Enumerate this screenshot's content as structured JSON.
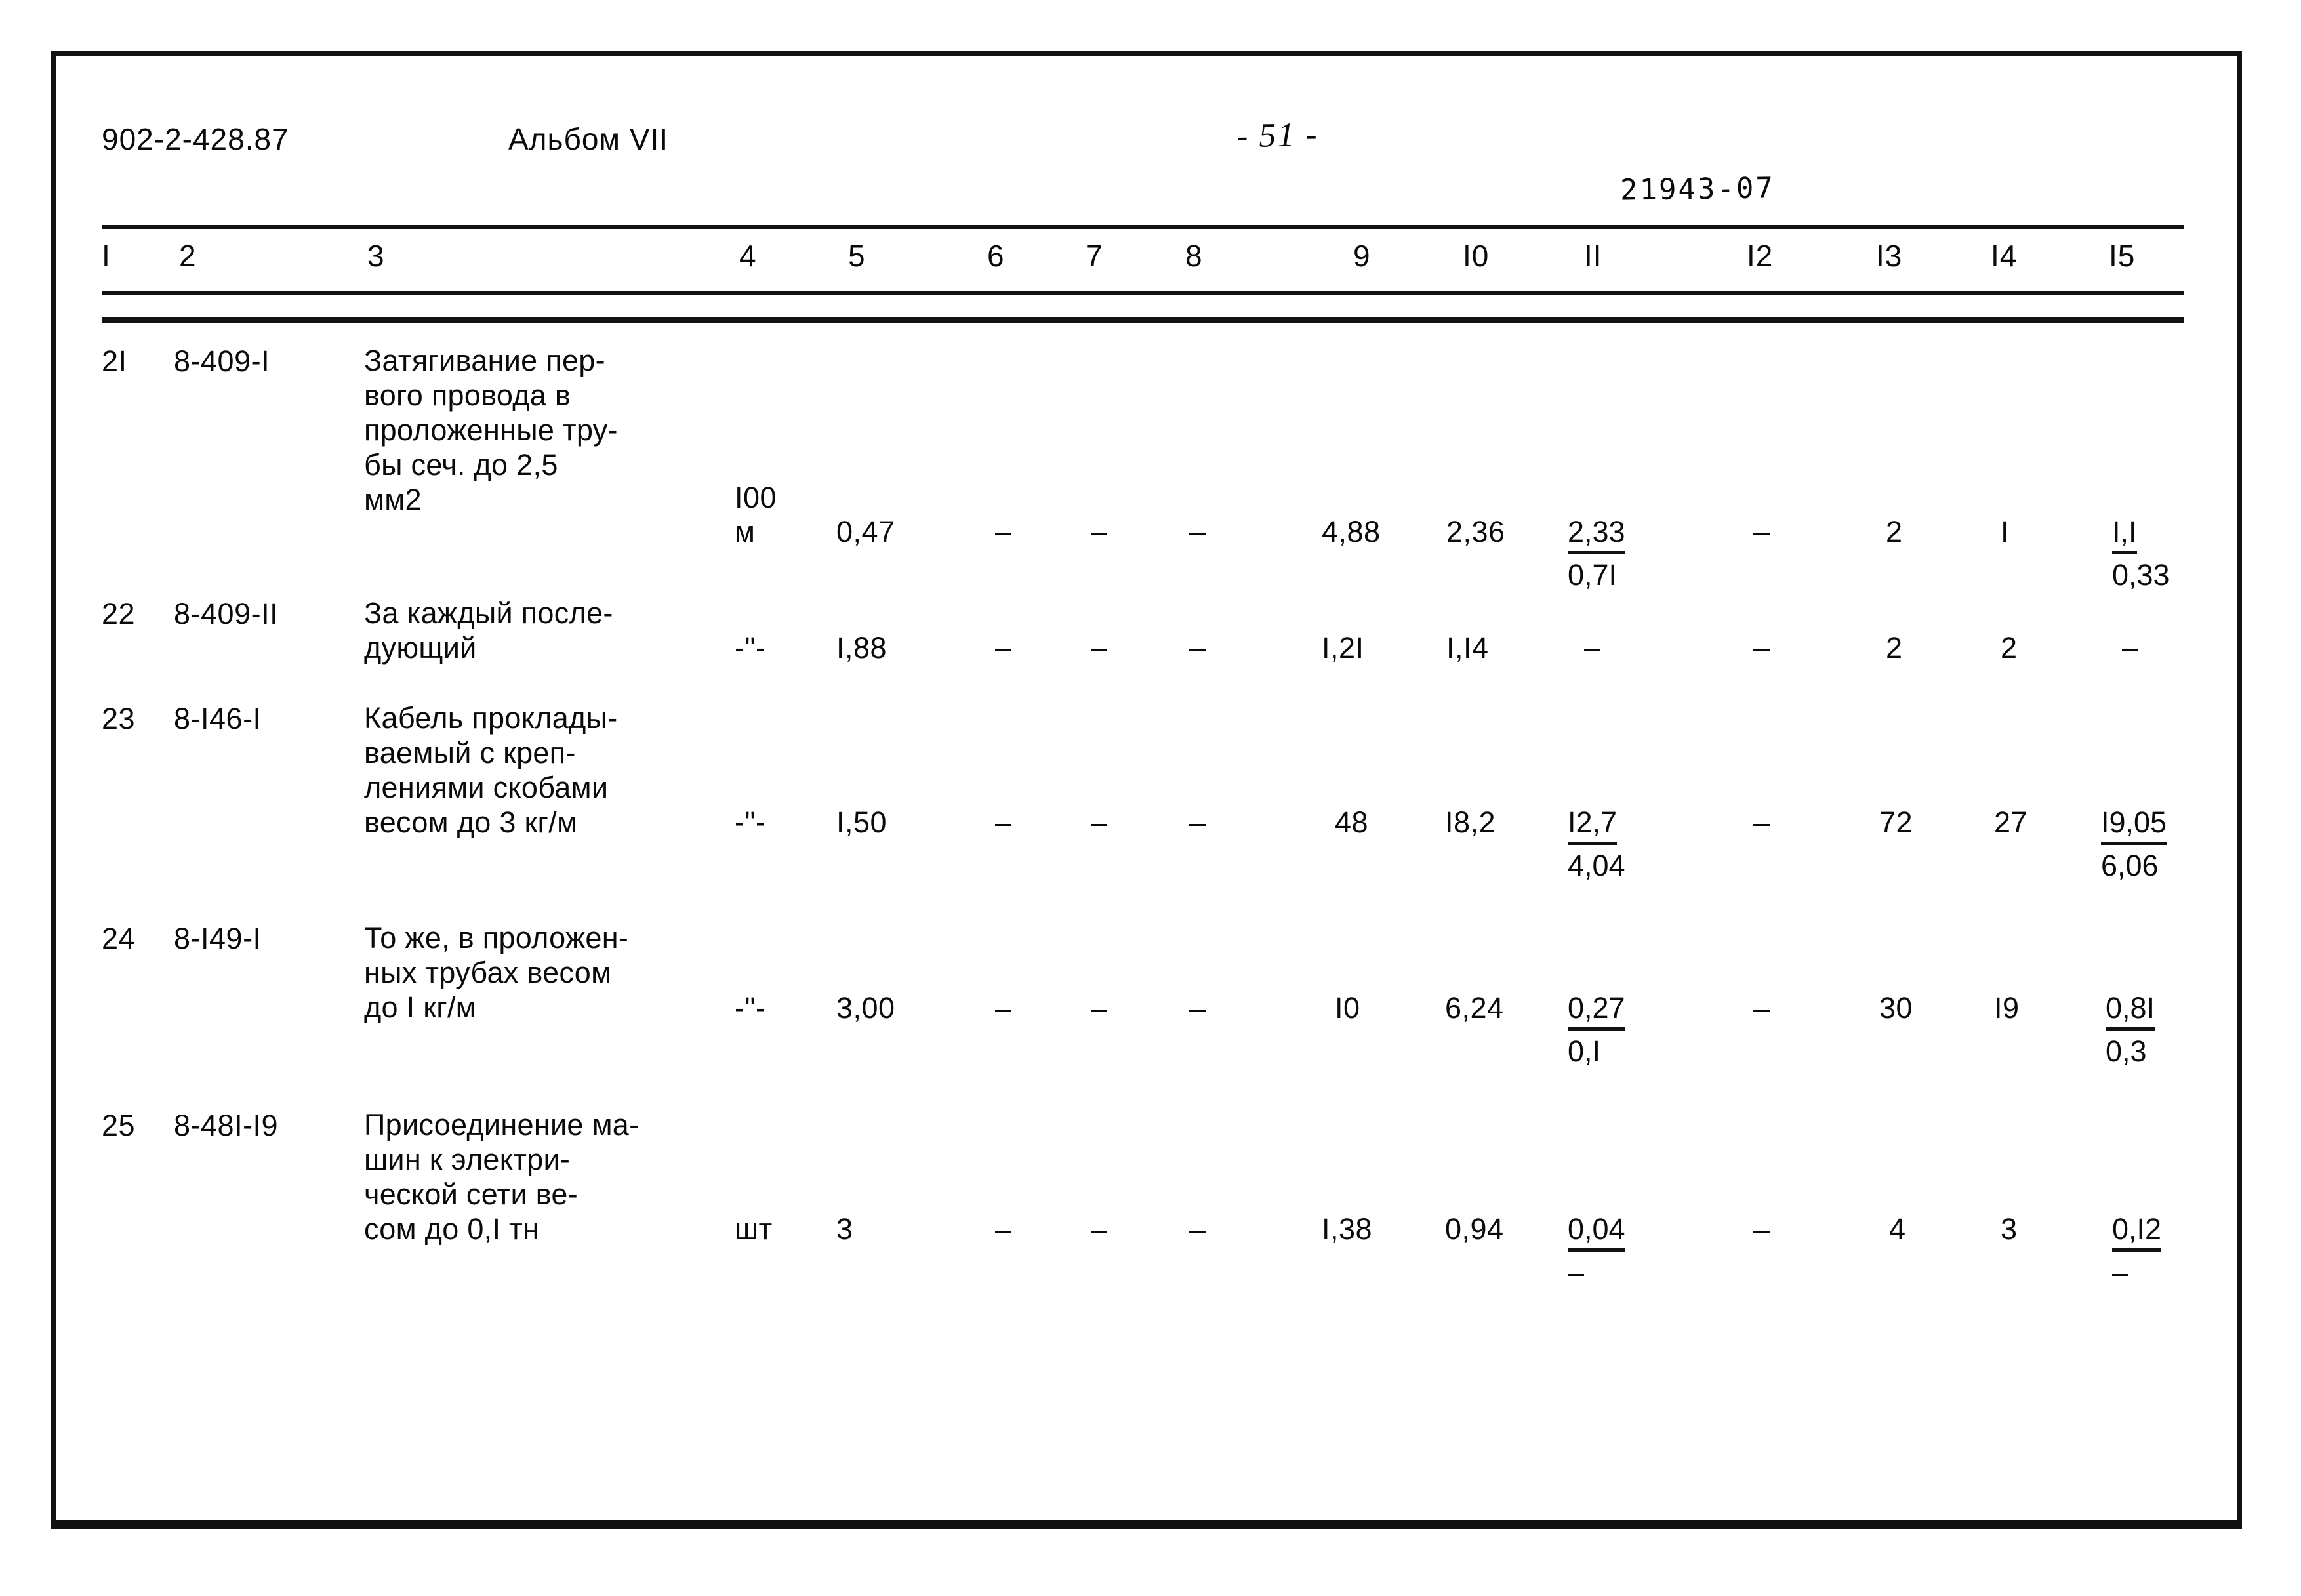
{
  "header": {
    "doc_code": "902-2-428.87",
    "album": "Альбом VII",
    "page_number": "- 51 -",
    "stamp_number": "21943-07"
  },
  "table": {
    "column_headers": [
      "I",
      "2",
      "3",
      "4",
      "5",
      "6",
      "7",
      "8",
      "9",
      "I0",
      "II",
      "I2",
      "I3",
      "I4",
      "I5"
    ],
    "rows": [
      {
        "no": "2I",
        "code": "8-409-I",
        "description": "Затягивание пер-\nвого провода в\nпроложенные тру-\nбы сеч. до 2,5\nмм2",
        "unit_line1": "I00",
        "unit_line2": "м",
        "c5": "0,47",
        "c6": "–",
        "c7": "–",
        "c8": "–",
        "c9": "4,88",
        "c10": "2,36",
        "c11_top": "2,33",
        "c11_bot": "0,7I",
        "c12": "–",
        "c13": "2",
        "c14": "I",
        "c15_top": "I,I",
        "c15_bot": "0,33"
      },
      {
        "no": "22",
        "code": "8-409-II",
        "description": "За каждый после-\nдующий",
        "unit_line1": "",
        "unit_line2": "-\"-",
        "c5": "I,88",
        "c6": "–",
        "c7": "–",
        "c8": "–",
        "c9": "I,2I",
        "c10": "I,I4",
        "c11_top": "–",
        "c11_bot": "",
        "c12": "–",
        "c13": "2",
        "c14": "2",
        "c15_top": "–",
        "c15_bot": ""
      },
      {
        "no": "23",
        "code": "8-I46-I",
        "description": "Кабель проклады-\nваемый с креп-\nлениями скобами\nвесом до 3 кг/м",
        "unit_line1": "",
        "unit_line2": "-\"-",
        "c5": "I,50",
        "c6": "–",
        "c7": "–",
        "c8": "–",
        "c9": "48",
        "c10": "I8,2",
        "c11_top": "I2,7",
        "c11_bot": "4,04",
        "c12": "–",
        "c13": "72",
        "c14": "27",
        "c15_top": "I9,05",
        "c15_bot": "6,06"
      },
      {
        "no": "24",
        "code": "8-I49-I",
        "description": "То же, в проложен-\nных трубах весом\nдо I кг/м",
        "unit_line1": "",
        "unit_line2": "-\"-",
        "c5": "3,00",
        "c6": "–",
        "c7": "–",
        "c8": "–",
        "c9": "I0",
        "c10": "6,24",
        "c11_top": "0,27",
        "c11_bot": "0,I",
        "c12": "–",
        "c13": "30",
        "c14": "I9",
        "c15_top": "0,8I",
        "c15_bot": "0,3"
      },
      {
        "no": "25",
        "code": "8-48I-I9",
        "description": "Присоединение ма-\nшин к электри-\nческой сети ве-\nсом до 0,I тн",
        "unit_line1": "",
        "unit_line2": "шт",
        "c5": "3",
        "c6": "–",
        "c7": "–",
        "c8": "–",
        "c9": "I,38",
        "c10": "0,94",
        "c11_top": "0,04",
        "c11_bot": "–",
        "c12": "–",
        "c13": "4",
        "c14": "3",
        "c15_top": "0,I2",
        "c15_bot": "–"
      }
    ]
  }
}
